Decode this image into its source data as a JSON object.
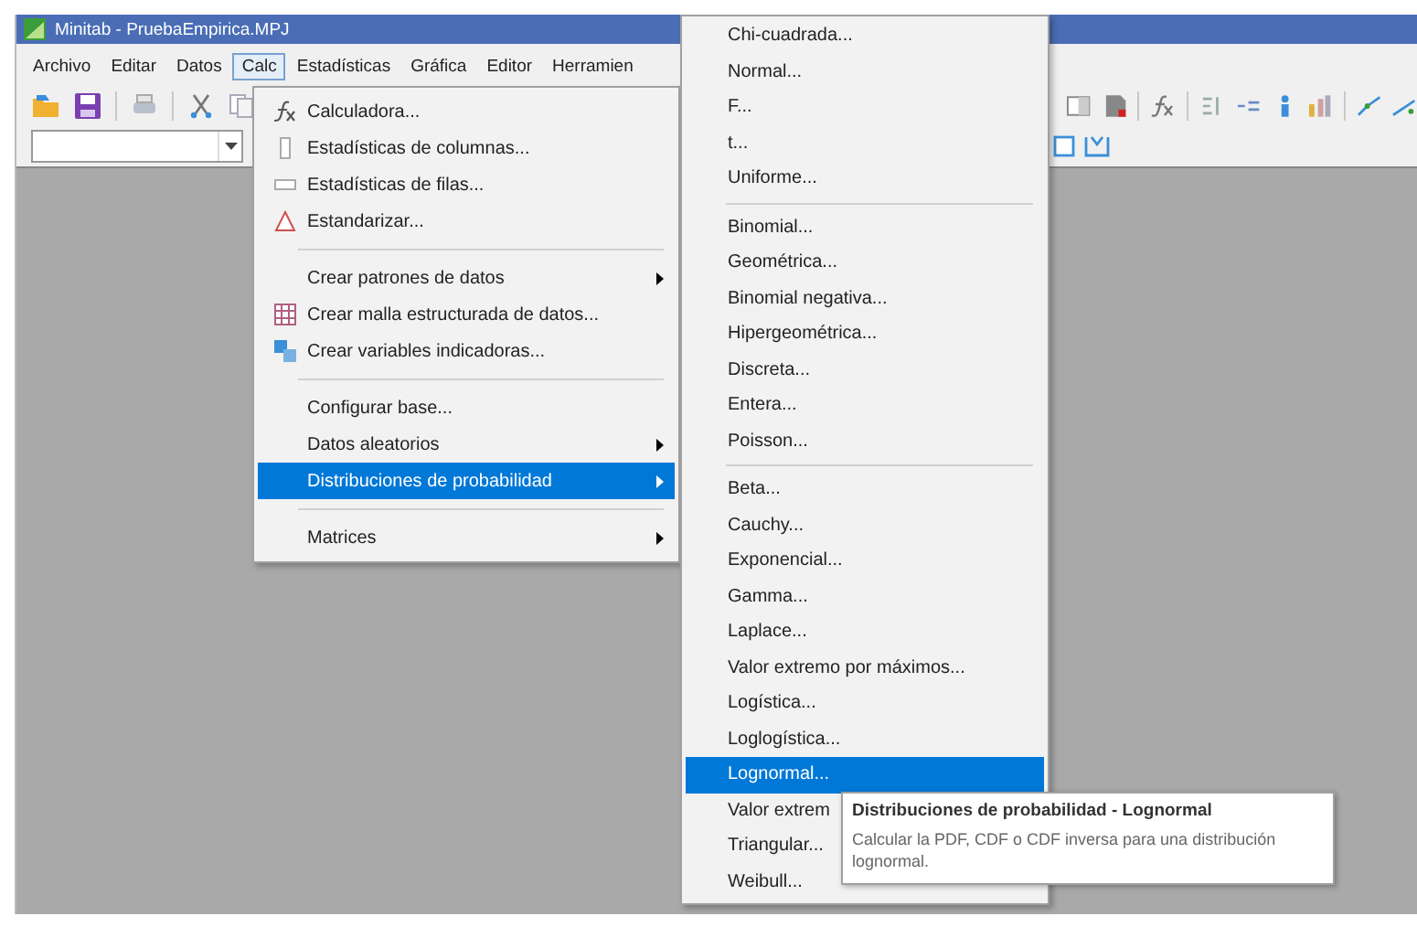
{
  "window": {
    "title": "Minitab - PruebaEmpirica.MPJ"
  },
  "menu_bar": [
    {
      "label": "Archivo",
      "selected": false
    },
    {
      "label": "Editar",
      "selected": false
    },
    {
      "label": "Datos",
      "selected": false
    },
    {
      "label": "Calc",
      "selected": true
    },
    {
      "label": "Estadísticas",
      "selected": false
    },
    {
      "label": "Gráfica",
      "selected": false
    },
    {
      "label": "Editor",
      "selected": false
    },
    {
      "label": "Herramien",
      "selected": false
    }
  ],
  "calc_menu": [
    {
      "kind": "item",
      "label": "Calculadora...",
      "submenu": false,
      "selected": false
    },
    {
      "kind": "item",
      "label": "Estadísticas de columnas...",
      "submenu": false,
      "selected": false
    },
    {
      "kind": "item",
      "label": "Estadísticas de filas...",
      "submenu": false,
      "selected": false
    },
    {
      "kind": "item",
      "label": "Estandarizar...",
      "submenu": false,
      "selected": false
    },
    {
      "kind": "separator"
    },
    {
      "kind": "item",
      "label": "Crear patrones de datos",
      "submenu": true,
      "selected": false
    },
    {
      "kind": "item",
      "label": "Crear malla estructurada de datos...",
      "submenu": false,
      "selected": false
    },
    {
      "kind": "item",
      "label": "Crear variables indicadoras...",
      "submenu": false,
      "selected": false
    },
    {
      "kind": "separator"
    },
    {
      "kind": "item",
      "label": "Configurar base...",
      "submenu": false,
      "selected": false
    },
    {
      "kind": "item",
      "label": "Datos aleatorios",
      "submenu": true,
      "selected": false
    },
    {
      "kind": "item",
      "label": "Distribuciones de probabilidad",
      "submenu": true,
      "selected": true
    },
    {
      "kind": "separator"
    },
    {
      "kind": "item",
      "label": "Matrices",
      "submenu": true,
      "selected": false
    }
  ],
  "distributions_menu": [
    {
      "kind": "item",
      "label": "Chi-cuadrada...",
      "selected": false
    },
    {
      "kind": "item",
      "label": "Normal...",
      "selected": false
    },
    {
      "kind": "item",
      "label": "F...",
      "selected": false
    },
    {
      "kind": "item",
      "label": "t...",
      "selected": false
    },
    {
      "kind": "item",
      "label": "Uniforme...",
      "selected": false
    },
    {
      "kind": "separator"
    },
    {
      "kind": "item",
      "label": "Binomial...",
      "selected": false
    },
    {
      "kind": "item",
      "label": "Geométrica...",
      "selected": false
    },
    {
      "kind": "item",
      "label": "Binomial negativa...",
      "selected": false
    },
    {
      "kind": "item",
      "label": "Hipergeométrica...",
      "selected": false
    },
    {
      "kind": "item",
      "label": "Discreta...",
      "selected": false
    },
    {
      "kind": "item",
      "label": "Entera...",
      "selected": false
    },
    {
      "kind": "item",
      "label": "Poisson...",
      "selected": false
    },
    {
      "kind": "separator"
    },
    {
      "kind": "item",
      "label": "Beta...",
      "selected": false
    },
    {
      "kind": "item",
      "label": "Cauchy...",
      "selected": false
    },
    {
      "kind": "item",
      "label": "Exponencial...",
      "selected": false
    },
    {
      "kind": "item",
      "label": "Gamma...",
      "selected": false
    },
    {
      "kind": "item",
      "label": "Laplace...",
      "selected": false
    },
    {
      "kind": "item",
      "label": "Valor extremo por máximos...",
      "selected": false
    },
    {
      "kind": "item",
      "label": "Logística...",
      "selected": false
    },
    {
      "kind": "item",
      "label": "Loglogística...",
      "selected": false
    },
    {
      "kind": "item",
      "label": "Lognormal...",
      "selected": true
    },
    {
      "kind": "item",
      "label": "Valor extrem",
      "selected": false
    },
    {
      "kind": "item",
      "label": "Triangular...",
      "selected": false
    },
    {
      "kind": "item",
      "label": "Weibull...",
      "selected": false
    }
  ],
  "tooltip": {
    "title": "Distribuciones de probabilidad - Lognormal",
    "text": "Calcular la PDF, CDF o CDF inversa para una distribución lognormal."
  }
}
